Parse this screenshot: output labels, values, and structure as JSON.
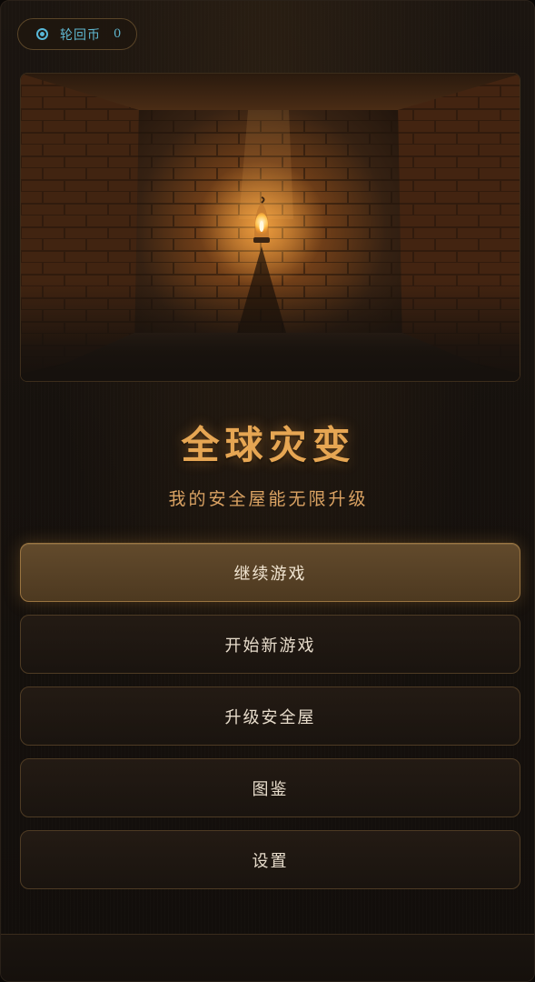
{
  "currency": {
    "label": "轮回币",
    "value": "0",
    "icon": "coin-ring-icon",
    "color": "#5fb6cf"
  },
  "hero": {
    "image": "lantern-in-stone-cellar",
    "accent": "#ffb347"
  },
  "title": "全球灾变",
  "subtitle": "我的安全屋能无限升级",
  "menu": {
    "items": [
      {
        "label": "继续游戏",
        "primary": true
      },
      {
        "label": "开始新游戏",
        "primary": false
      },
      {
        "label": "升级安全屋",
        "primary": false
      },
      {
        "label": "图鉴",
        "primary": false
      },
      {
        "label": "设置",
        "primary": false
      }
    ]
  },
  "colors": {
    "title": "#e6a653",
    "subtitle": "#dba363",
    "button_text": "#e7dccb",
    "primary_button_bg": "#5a4327",
    "background": "#16110d"
  }
}
